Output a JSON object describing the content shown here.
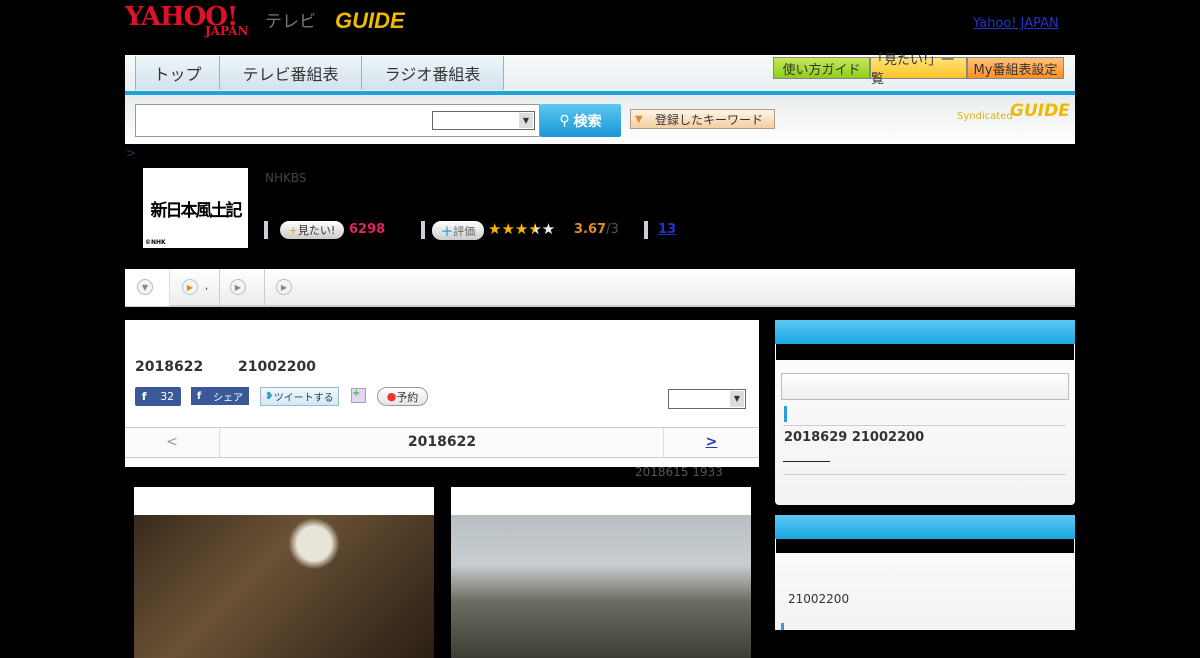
{
  "header": {
    "logo_yahoo": "YAHOO!",
    "logo_japan": "JAPAN",
    "logo_tv": "テレビ",
    "logo_gguide": "GUIDE",
    "yahoo_japan_link": "Yahoo! JAPAN"
  },
  "nav": {
    "tabs": [
      "トップ",
      "テレビ番組表",
      "ラジオ番組表"
    ],
    "right_buttons": [
      {
        "label": "使い方ガイド",
        "color": "#a6d829"
      },
      {
        "label": "「見たい!」一覧",
        "color": "#ffd24a"
      },
      {
        "label": "My番組表設定",
        "color": "#ffa43c"
      }
    ]
  },
  "search": {
    "value": "",
    "button": "検索",
    "keyword_button": "登録したキーワード",
    "syndicated": "Syndicated",
    "syndicated_logo": "GUIDE"
  },
  "breadcrumb": ">",
  "program": {
    "thumb_text": "新日本風土記",
    "copyright": "©NHK",
    "channel": "NHKBS",
    "want_label": "見たい!",
    "want_count": "6298",
    "rate_label": "評価",
    "rating": "3.67",
    "rating_suffix": "/3",
    "stars_fraction": 0.73,
    "link_count": "13"
  },
  "subtabs": [
    {
      "label": ""
    },
    {
      "label": ","
    },
    {
      "label": ""
    },
    {
      "label": ""
    }
  ],
  "main": {
    "date": "2018622",
    "time": "21002200",
    "fb_count": "32",
    "fb_share": "シェア",
    "tweet": "ツイートする",
    "reserve": "予約",
    "prev": "<",
    "current_date": "2018622",
    "next": ">",
    "updated": "2018615  1933"
  },
  "side1": {
    "item": "2018629  21002200"
  },
  "side2": {
    "item": "21002200"
  },
  "colors": {
    "accent": "#1ea3dc",
    "want": "#e0245e",
    "rating": "#e38a2c"
  }
}
